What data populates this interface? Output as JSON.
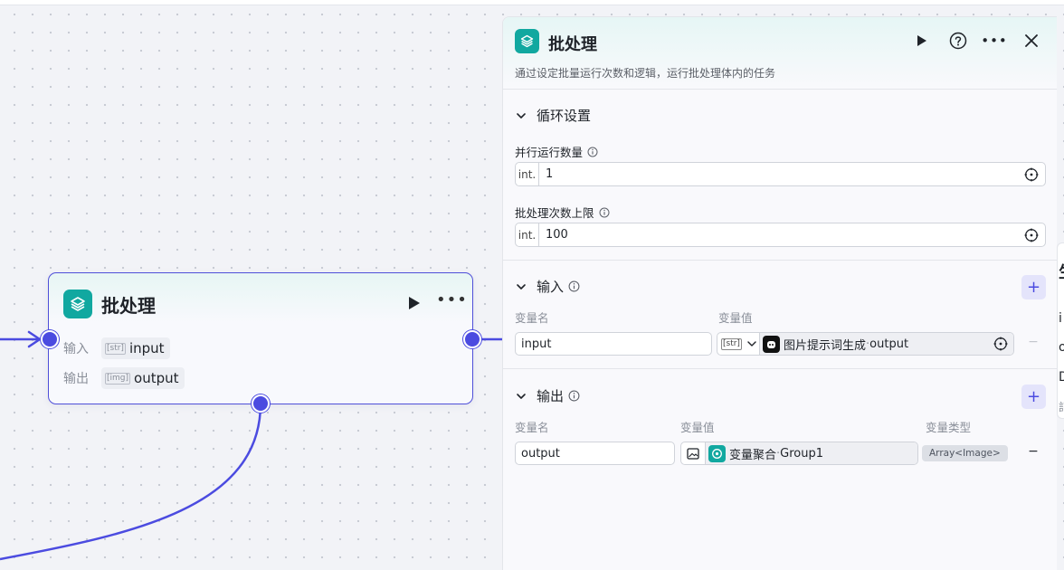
{
  "canvas": {
    "node": {
      "title": "批处理",
      "input_label": "输入",
      "input_type": "[str]",
      "input_value": "input",
      "output_label": "输出",
      "output_type": "[img]",
      "output_value": "output"
    },
    "behind_node": {
      "chars": [
        "生",
        "i",
        "o",
        "D",
        "記"
      ]
    }
  },
  "panel": {
    "title": "批处理",
    "description": "通过设定批量运行次数和逻辑，运行批处理体内的任务",
    "loop_section": {
      "title": "循环设置",
      "parallel_label": "并行运行数量",
      "parallel_prefix": "int.",
      "parallel_value": "1",
      "limit_label": "批处理次数上限",
      "limit_prefix": "int.",
      "limit_value": "100"
    },
    "input_section": {
      "title": "输入",
      "col_name": "变量名",
      "col_value": "变量值",
      "row": {
        "name": "input",
        "type_tag": "[str]",
        "ref_node": "图片提示词生成",
        "ref_sep": " · ",
        "ref_var": "output"
      }
    },
    "output_section": {
      "title": "输出",
      "col_name": "变量名",
      "col_value": "变量值",
      "col_type": "变量类型",
      "row": {
        "name": "output",
        "ref_node": "变量聚合",
        "ref_sep": " · ",
        "ref_var": "Group1",
        "type": "Array<Image>"
      }
    }
  },
  "colors": {
    "accent": "#4b4be0",
    "brand_teal": "#11a8a0"
  },
  "icons": [
    "layers-icon",
    "play-icon",
    "help-icon",
    "more-icon",
    "close-icon",
    "chevron-down-icon",
    "info-icon",
    "target-icon",
    "plus-icon",
    "minus-icon",
    "image-icon",
    "aggregate-icon",
    "bot-icon"
  ]
}
